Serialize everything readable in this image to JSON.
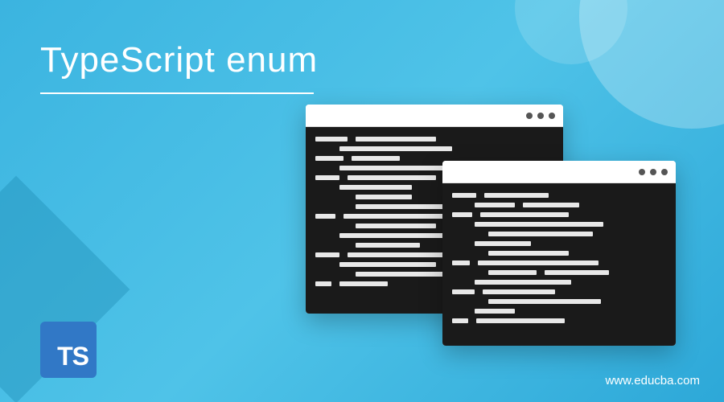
{
  "title": "TypeScript enum",
  "ts_badge": "TS",
  "website_url": "www.educba.com",
  "colors": {
    "background_primary": "#3bb4e0",
    "background_secondary": "#2da8d8",
    "ts_badge_bg": "#3178c6",
    "text_white": "#ffffff",
    "code_bg": "#1a1a1a"
  }
}
